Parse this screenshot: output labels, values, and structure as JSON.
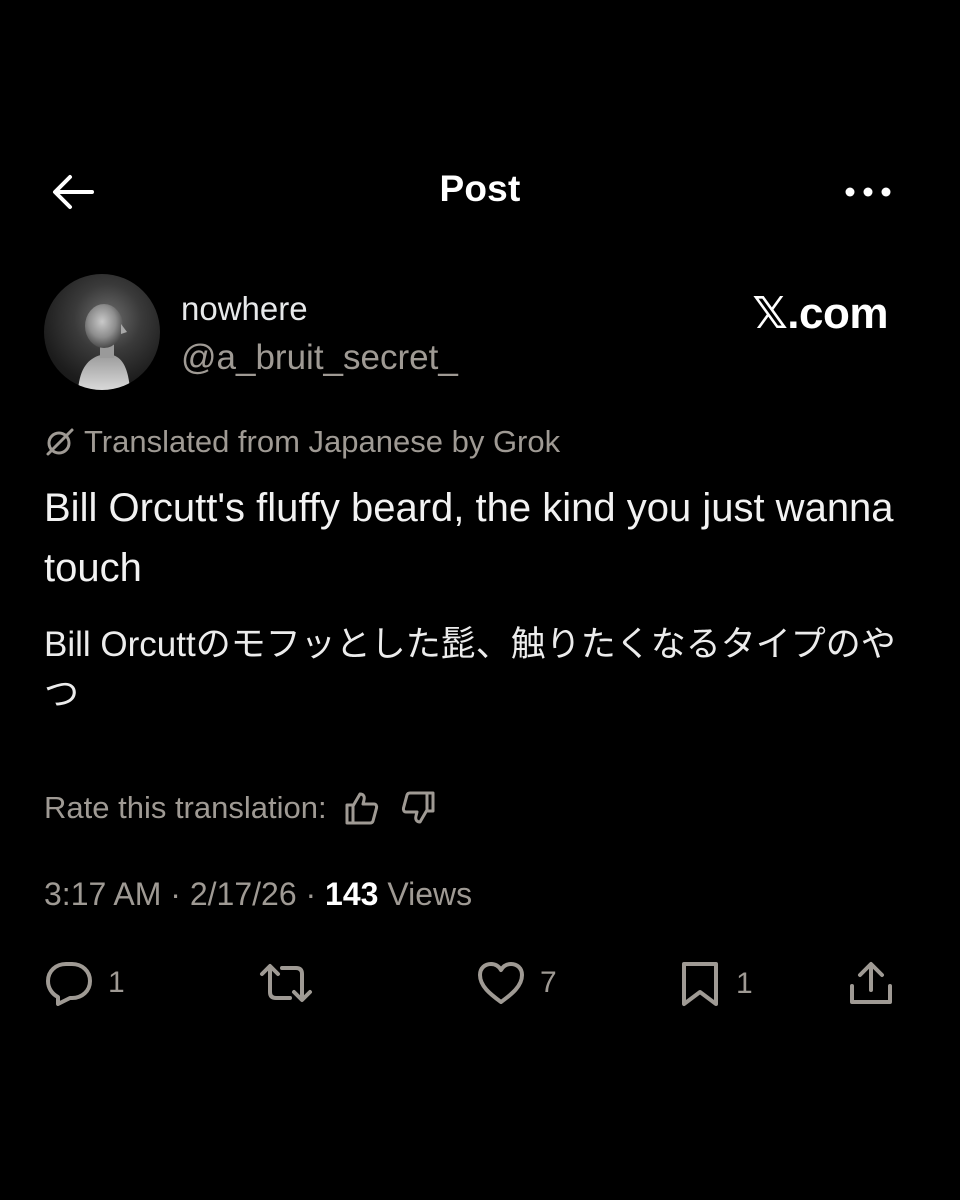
{
  "header": {
    "title": "Post"
  },
  "author": {
    "display_name": "nowhere",
    "handle": "@a_bruit_secret_"
  },
  "brand": "𝕏.com",
  "translation": {
    "label": "Translated from Japanese by Grok",
    "text": "Bill Orcutt's fluffy beard, the kind you just wanna touch",
    "original": "Bill Orcuttのモフッとした髭、触りたくなるタイプのやつ",
    "rate_label": "Rate this translation:"
  },
  "meta": {
    "time": "3:17 AM",
    "date": "2/17/26",
    "views_count": "143",
    "views_label": "Views"
  },
  "actions": {
    "replies": "1",
    "reposts": "",
    "likes": "7",
    "bookmarks": "1"
  },
  "colors": {
    "background": "#000000",
    "text_primary": "#e7e9ea",
    "text_secondary": "#9f9a94"
  },
  "icons": [
    "back-arrow-icon",
    "more-dots-icon",
    "grok-icon",
    "thumbs-up-icon",
    "thumbs-down-icon",
    "reply-icon",
    "repost-icon",
    "like-icon",
    "bookmark-icon",
    "share-icon"
  ]
}
